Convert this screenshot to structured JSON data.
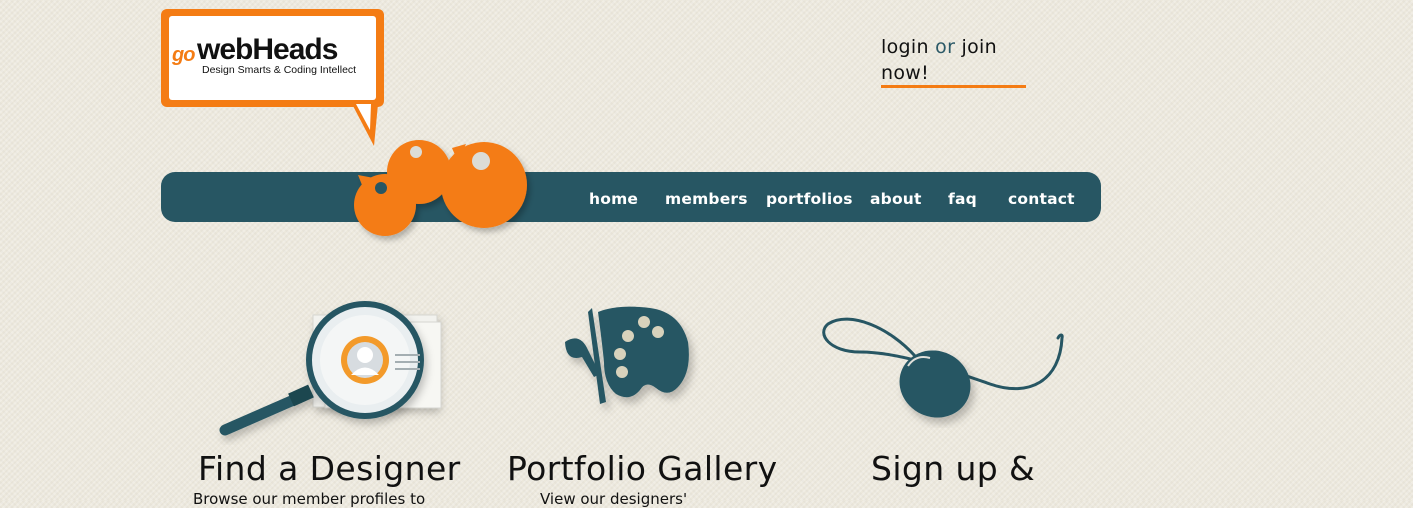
{
  "brand": {
    "logo_prefix": "go",
    "logo_name": "webHeads",
    "tagline": "Design Smarts & Coding Intellect",
    "accent": "#f47c14",
    "nav_color": "#275663"
  },
  "auth": {
    "login_label": "login",
    "or_label": "or",
    "join_label": "join",
    "now_label": "now!"
  },
  "nav": {
    "items": [
      {
        "label": "home"
      },
      {
        "label": "members"
      },
      {
        "label": "portfolios"
      },
      {
        "label": "about"
      },
      {
        "label": "faq"
      },
      {
        "label": "contact"
      }
    ]
  },
  "features": [
    {
      "title": "Find a Designer",
      "icon": "magnifier-profile-icon",
      "desc": "Browse our member profiles to"
    },
    {
      "title": "Portfolio Gallery",
      "icon": "palette-butterfly-icon",
      "desc": "View our designers'"
    },
    {
      "title": "Sign up &",
      "icon": "computer-mouse-icon",
      "desc": ""
    }
  ]
}
